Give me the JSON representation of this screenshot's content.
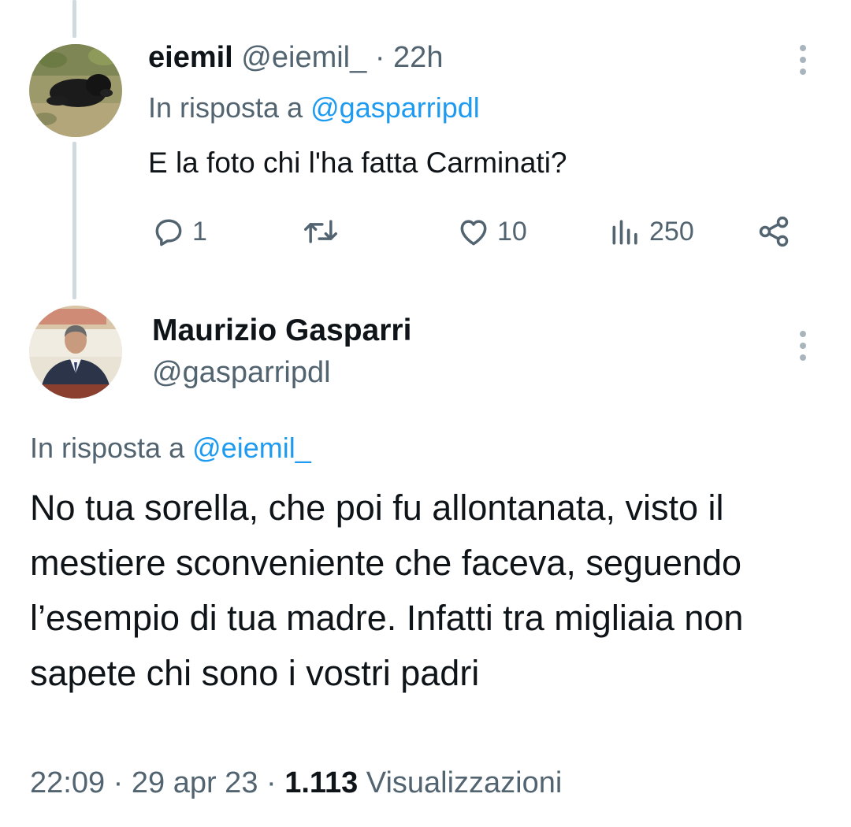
{
  "reply_tweet": {
    "display_name": "eiemil",
    "handle": "@eiemil_",
    "separator": "·",
    "time": "22h",
    "reply_prefix": "In risposta a",
    "reply_to": "@gasparripdl",
    "text": "E la foto chi l'ha fatta Carminati?",
    "actions": {
      "reply_count": "1",
      "retweet_count": "",
      "like_count": "10",
      "view_count": "250"
    }
  },
  "main_tweet": {
    "display_name": "Maurizio Gasparri",
    "handle": "@gasparripdl",
    "reply_prefix": "In risposta a",
    "reply_to": "@eiemil_",
    "text": "No tua sorella, che poi fu allontanata, visto il mestiere sconveniente che faceva, seguendo l’esempio di tua madre. Infatti tra migliaia non sapete chi sono i vostri padri",
    "time": "22:09",
    "date": "29 apr 23",
    "separator": "·",
    "views_count": "1.113",
    "views_label": "Visualizzazioni"
  },
  "colors": {
    "link": "#1d9bf0",
    "secondary_text": "#536471",
    "primary_text": "#0f1419",
    "thread_line": "#cfd9de"
  },
  "icons": [
    "reply-icon",
    "retweet-icon",
    "like-icon",
    "views-icon",
    "share-icon",
    "more-options-icon"
  ]
}
